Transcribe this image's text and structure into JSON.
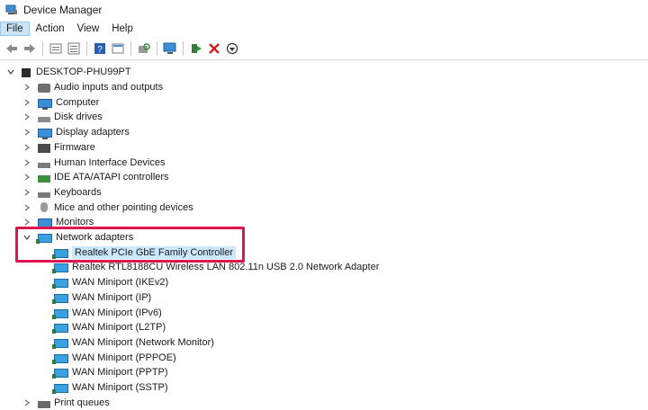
{
  "window": {
    "title": "Device Manager"
  },
  "menu": [
    "File",
    "Action",
    "View",
    "Help"
  ],
  "toolbar_icons": [
    "back-arrow-icon",
    "forward-arrow-icon",
    "properties-icon",
    "list-icon",
    "help-icon",
    "view-icon",
    "scan-hardware-icon",
    "monitor-icon",
    "update-driver-icon",
    "uninstall-icon",
    "disable-icon"
  ],
  "tree": {
    "root": "DESKTOP-PHU99PT",
    "categories": [
      {
        "label": "Audio inputs and outputs",
        "icon": "speaker-icon"
      },
      {
        "label": "Computer",
        "icon": "computer-icon"
      },
      {
        "label": "Disk drives",
        "icon": "disk-drive-icon"
      },
      {
        "label": "Display adapters",
        "icon": "display-adapter-icon"
      },
      {
        "label": "Firmware",
        "icon": "firmware-icon"
      },
      {
        "label": "Human Interface Devices",
        "icon": "hid-icon"
      },
      {
        "label": "IDE ATA/ATAPI controllers",
        "icon": "ide-controller-icon"
      },
      {
        "label": "Keyboards",
        "icon": "keyboard-icon"
      },
      {
        "label": "Mice and other pointing devices",
        "icon": "mouse-icon"
      },
      {
        "label": "Monitors",
        "icon": "monitor-icon"
      },
      {
        "label": "Network adapters",
        "icon": "network-adapter-icon"
      }
    ],
    "network_children": [
      "Realtek PCIe GbE Family Controller",
      "Realtek RTL8188CU Wireless LAN 802.11n USB 2.0 Network Adapter",
      "WAN Miniport (IKEv2)",
      "WAN Miniport (IP)",
      "WAN Miniport (IPv6)",
      "WAN Miniport (L2TP)",
      "WAN Miniport (Network Monitor)",
      "WAN Miniport (PPPOE)",
      "WAN Miniport (PPTP)",
      "WAN Miniport (SSTP)"
    ],
    "last_category": {
      "label": "Print queues",
      "icon": "printer-icon"
    },
    "selected": "Realtek PCIe GbE Family Controller"
  },
  "colors": {
    "highlight_box": "#e0154e",
    "selection": "#cce8ff"
  }
}
